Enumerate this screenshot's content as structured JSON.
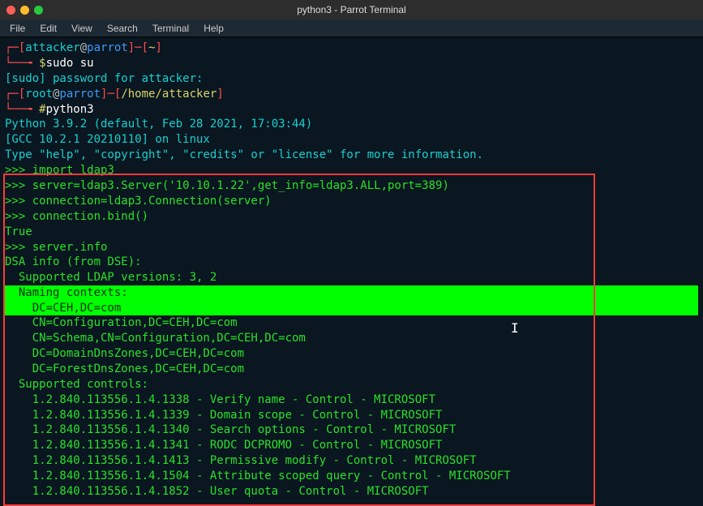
{
  "window": {
    "title": "python3 - Parrot Terminal"
  },
  "menu": {
    "file": "File",
    "edit": "Edit",
    "view": "View",
    "search": "Search",
    "terminal": "Terminal",
    "help": "Help"
  },
  "prompt1": {
    "open": "┌─[",
    "user": "attacker",
    "at": "@",
    "host": "parrot",
    "mid": "]─[",
    "path": "~",
    "close": "]"
  },
  "prompt1b": {
    "prefix": "└──╼ ",
    "sym": "$",
    "cmd": "sudo su"
  },
  "sudo_line": "[sudo] password for attacker:",
  "prompt2": {
    "open": "┌─[",
    "user": "root",
    "at": "@",
    "host": "parrot",
    "mid": "]─[",
    "path": "/home/attacker",
    "close": "]"
  },
  "prompt2b": {
    "prefix": "└──╼ ",
    "sym": "#",
    "cmd": "python3"
  },
  "py_banner1": "Python 3.9.2 (default, Feb 28 2021, 17:03:44)",
  "py_banner2": "[GCC 10.2.1 20210110] on linux",
  "py_banner3": "Type \"help\", \"copyright\", \"credits\" or \"license\" for more information.",
  "repl": {
    "l1": ">>> import ldap3",
    "l2": ">>> server=ldap3.Server('10.10.1.22',get_info=ldap3.ALL,port=389)",
    "l3": ">>> connection=ldap3.Connection(server)",
    "l4": ">>> connection.bind()",
    "l5": "True",
    "l6": ">>> server.info"
  },
  "dsa": {
    "header": "DSA info (from DSE):",
    "ldapver": "  Supported LDAP versions: 3, 2",
    "nc_label": "  Naming contexts:",
    "nc1": "    DC=CEH,DC=com",
    "nc2": "    CN=Configuration,DC=CEH,DC=com",
    "nc3": "    CN=Schema,CN=Configuration,DC=CEH,DC=com",
    "nc4": "    DC=DomainDnsZones,DC=CEH,DC=com",
    "nc5": "    DC=ForestDnsZones,DC=CEH,DC=com",
    "sc_label": "  Supported controls:",
    "sc1": "    1.2.840.113556.1.4.1338 - Verify name - Control - MICROSOFT",
    "sc2": "    1.2.840.113556.1.4.1339 - Domain scope - Control - MICROSOFT",
    "sc3": "    1.2.840.113556.1.4.1340 - Search options - Control - MICROSOFT",
    "sc4": "    1.2.840.113556.1.4.1341 - RODC DCPROMO - Control - MICROSOFT",
    "sc5": "    1.2.840.113556.1.4.1413 - Permissive modify - Control - MICROSOFT",
    "sc6": "    1.2.840.113556.1.4.1504 - Attribute scoped query - Control - MICROSOFT",
    "sc7": "    1.2.840.113556.1.4.1852 - User quota - Control - MICROSOFT"
  },
  "cursor_glyph": "I"
}
